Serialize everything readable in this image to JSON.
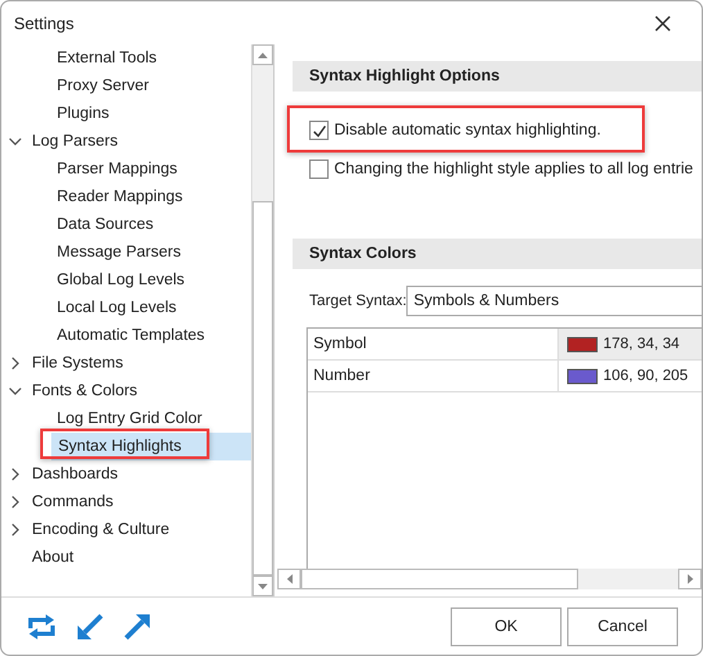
{
  "window": {
    "title": "Settings"
  },
  "tree": [
    {
      "children": [
        {
          "label": "External Tools",
          "selected": false
        },
        {
          "label": "Proxy Server",
          "selected": false
        },
        {
          "label": "Plugins",
          "selected": false
        }
      ]
    },
    {
      "label": "Log Parsers",
      "expanded": true,
      "selected": false,
      "children": [
        {
          "label": "Parser Mappings",
          "selected": false
        },
        {
          "label": "Reader Mappings",
          "selected": false
        },
        {
          "label": "Data Sources",
          "selected": false
        },
        {
          "label": "Message Parsers",
          "selected": false
        },
        {
          "label": "Global Log Levels",
          "selected": false
        },
        {
          "label": "Local Log Levels",
          "selected": false
        },
        {
          "label": "Automatic Templates",
          "selected": false
        }
      ]
    },
    {
      "label": "File Systems",
      "expanded": false,
      "selected": false
    },
    {
      "label": "Fonts & Colors",
      "expanded": true,
      "selected": false,
      "children": [
        {
          "label": "Log Entry Grid Color",
          "selected": false
        },
        {
          "label": "Syntax Highlights",
          "selected": true,
          "highlighted": true
        }
      ]
    },
    {
      "label": "Dashboards",
      "expanded": false,
      "selected": false
    },
    {
      "label": "Commands",
      "expanded": false,
      "selected": false
    },
    {
      "label": "Encoding & Culture",
      "expanded": false,
      "selected": false
    },
    {
      "label": "About",
      "selected": false
    }
  ],
  "options": {
    "title": "Syntax Highlight Options",
    "checkboxes": [
      {
        "label": "Disable automatic syntax highlighting.",
        "checked": true,
        "highlighted": true
      },
      {
        "label": "Changing the highlight style applies to all log entrie",
        "checked": false,
        "highlighted": false
      }
    ]
  },
  "colors": {
    "title": "Syntax Colors",
    "target_label": "Target Syntax:",
    "target_value": "Symbols & Numbers",
    "rows": [
      {
        "name": "Symbol",
        "color": "#b22222",
        "value": "178, 34, 34",
        "selected": true
      },
      {
        "name": "Number",
        "color": "#6a5acd",
        "value": "106, 90, 205",
        "selected": false
      }
    ]
  },
  "buttons": [
    "OK",
    "Cancel"
  ]
}
